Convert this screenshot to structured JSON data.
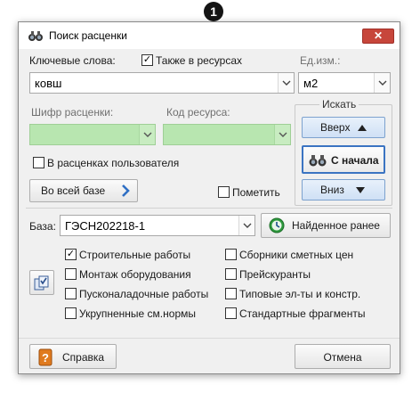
{
  "marker": "1",
  "window": {
    "title": "Поиск расценки",
    "close_label": "✕"
  },
  "keywords": {
    "label": "Ключевые слова:",
    "also_resources_label": "Также в ресурсах",
    "also_resources_checked": true,
    "value": "ковш"
  },
  "unit": {
    "label": "Ед.изм.:",
    "value": "м2"
  },
  "code": {
    "label": "Шифр расценки:",
    "value": ""
  },
  "resource_code": {
    "label": "Код ресурса:",
    "value": ""
  },
  "user_rates": {
    "label": "В расценках пользователя",
    "checked": false
  },
  "whole_base_button": "Во всей базе",
  "mark": {
    "label": "Пометить",
    "checked": false
  },
  "search_group": {
    "title": "Искать",
    "up_label": "Вверх",
    "from_start_label": "С начала",
    "down_label": "Вниз"
  },
  "base": {
    "label": "База:",
    "value": "ГЭСН202218-1",
    "found_earlier_label": "Найденное ранее"
  },
  "categories": {
    "left": [
      {
        "label": "Строительные работы",
        "checked": true
      },
      {
        "label": "Монтаж оборудования",
        "checked": false
      },
      {
        "label": "Пусконаладочные работы",
        "checked": false
      },
      {
        "label": "Укрупненные см.нормы",
        "checked": false
      }
    ],
    "right": [
      {
        "label": "Сборники сметных цен",
        "checked": false
      },
      {
        "label": "Прейскуранты",
        "checked": false
      },
      {
        "label": "Типовые эл-ты и констр.",
        "checked": false
      },
      {
        "label": "Стандартные фрагменты",
        "checked": false
      }
    ]
  },
  "footer": {
    "help_label": "Справка",
    "cancel_label": "Отмена"
  },
  "colors": {
    "green_field": "#b8e6b0",
    "close_button": "#c7463b",
    "accent_blue": "#2f6fc4"
  }
}
